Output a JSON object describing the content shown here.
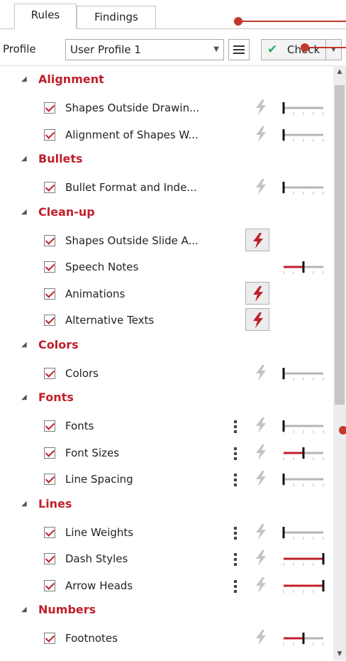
{
  "tabs": [
    {
      "label": "Rules",
      "active": true
    },
    {
      "label": "Findings",
      "active": false
    }
  ],
  "profile": {
    "label": "Profile",
    "value": "User Profile 1",
    "check_label": "Check"
  },
  "colors": {
    "accent": "#c0202a",
    "check": "#27ae60"
  },
  "groups": [
    {
      "title": "Alignment",
      "rules": [
        {
          "name": "Shapes Outside Drawin...",
          "checked": true,
          "more": false,
          "action": "disabled",
          "level": 0.0
        },
        {
          "name": "Alignment of Shapes W...",
          "checked": true,
          "more": false,
          "action": "disabled",
          "level": 0.0
        }
      ]
    },
    {
      "title": "Bullets",
      "rules": [
        {
          "name": "Bullet Format and Inde...",
          "checked": true,
          "more": false,
          "action": "disabled",
          "level": 0.0
        }
      ]
    },
    {
      "title": "Clean-up",
      "rules": [
        {
          "name": "Shapes Outside Slide A...",
          "checked": true,
          "more": false,
          "action": "active",
          "level": null
        },
        {
          "name": "Speech Notes",
          "checked": true,
          "more": false,
          "action": "none",
          "level": 0.5
        },
        {
          "name": "Animations",
          "checked": true,
          "more": false,
          "action": "active",
          "level": null
        },
        {
          "name": "Alternative Texts",
          "checked": true,
          "more": false,
          "action": "active",
          "level": null
        }
      ]
    },
    {
      "title": "Colors",
      "rules": [
        {
          "name": "Colors",
          "checked": true,
          "more": false,
          "action": "disabled",
          "level": 0.0
        }
      ]
    },
    {
      "title": "Fonts",
      "rules": [
        {
          "name": "Fonts",
          "checked": true,
          "more": true,
          "action": "disabled",
          "level": 0.0
        },
        {
          "name": "Font Sizes",
          "checked": true,
          "more": true,
          "action": "disabled",
          "level": 0.5
        },
        {
          "name": "Line Spacing",
          "checked": true,
          "more": true,
          "action": "disabled",
          "level": 0.0
        }
      ]
    },
    {
      "title": "Lines",
      "rules": [
        {
          "name": "Line Weights",
          "checked": true,
          "more": true,
          "action": "disabled",
          "level": 0.0
        },
        {
          "name": "Dash Styles",
          "checked": true,
          "more": true,
          "action": "disabled",
          "level": 1.0
        },
        {
          "name": "Arrow Heads",
          "checked": true,
          "more": true,
          "action": "disabled",
          "level": 1.0
        }
      ]
    },
    {
      "title": "Numbers",
      "rules": [
        {
          "name": "Footnotes",
          "checked": true,
          "more": false,
          "action": "disabled",
          "level": 0.5
        }
      ]
    }
  ]
}
